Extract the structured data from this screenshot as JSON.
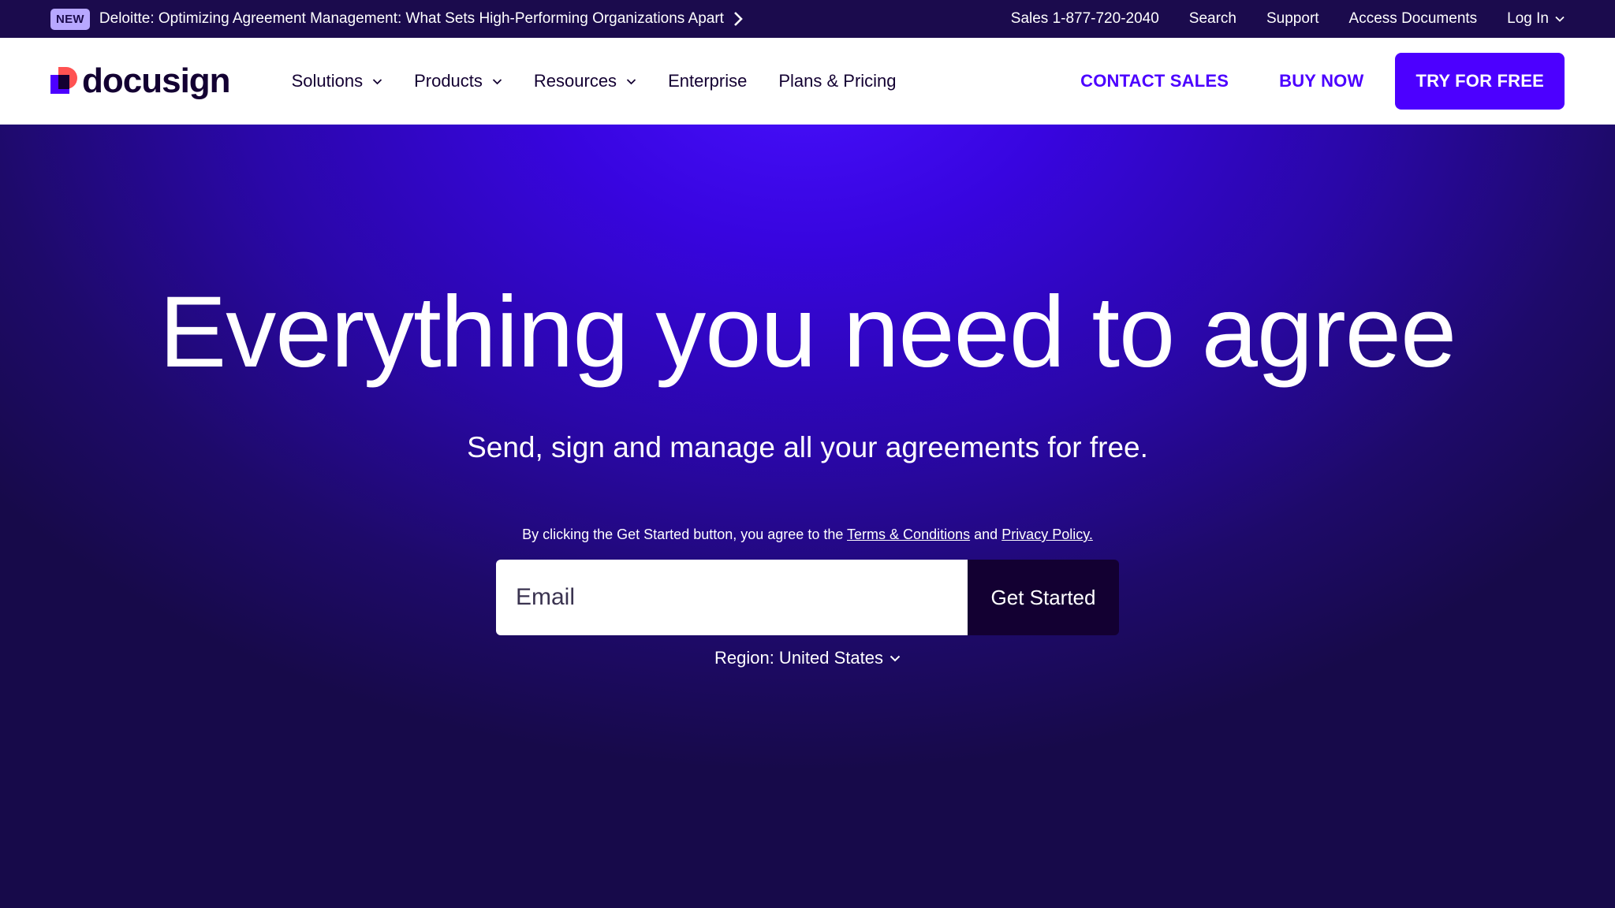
{
  "topbar": {
    "badge": "NEW",
    "promo_text": "Deloitte: Optimizing Agreement Management: What Sets High-Performing Organizations Apart",
    "links": {
      "sales": "Sales 1-877-720-2040",
      "search": "Search",
      "support": "Support",
      "access_documents": "Access Documents",
      "login": "Log In"
    }
  },
  "navbar": {
    "logo_text": "docusign",
    "items": {
      "solutions": "Solutions",
      "products": "Products",
      "resources": "Resources",
      "enterprise": "Enterprise",
      "pricing": "Plans & Pricing"
    },
    "contact_sales": "CONTACT SALES",
    "buy_now": "BUY NOW",
    "try_free": "TRY FOR FREE"
  },
  "hero": {
    "title": "Everything you need to agree",
    "subtitle": "Send, sign and manage all your agreements for free.",
    "consent_prefix": "By clicking the Get Started button, you agree to the",
    "terms_link": "Terms & Conditions",
    "consent_and": "and",
    "privacy_link": "Privacy Policy.",
    "email_placeholder": "Email",
    "get_started": "Get Started",
    "region": "Region: United States"
  },
  "colors": {
    "brand_purple": "#4c00ff",
    "dark_navy": "#130032",
    "topbar_bg": "#1b0b4d",
    "badge_bg": "#b7a7ff",
    "logo_red": "#ff5252"
  }
}
